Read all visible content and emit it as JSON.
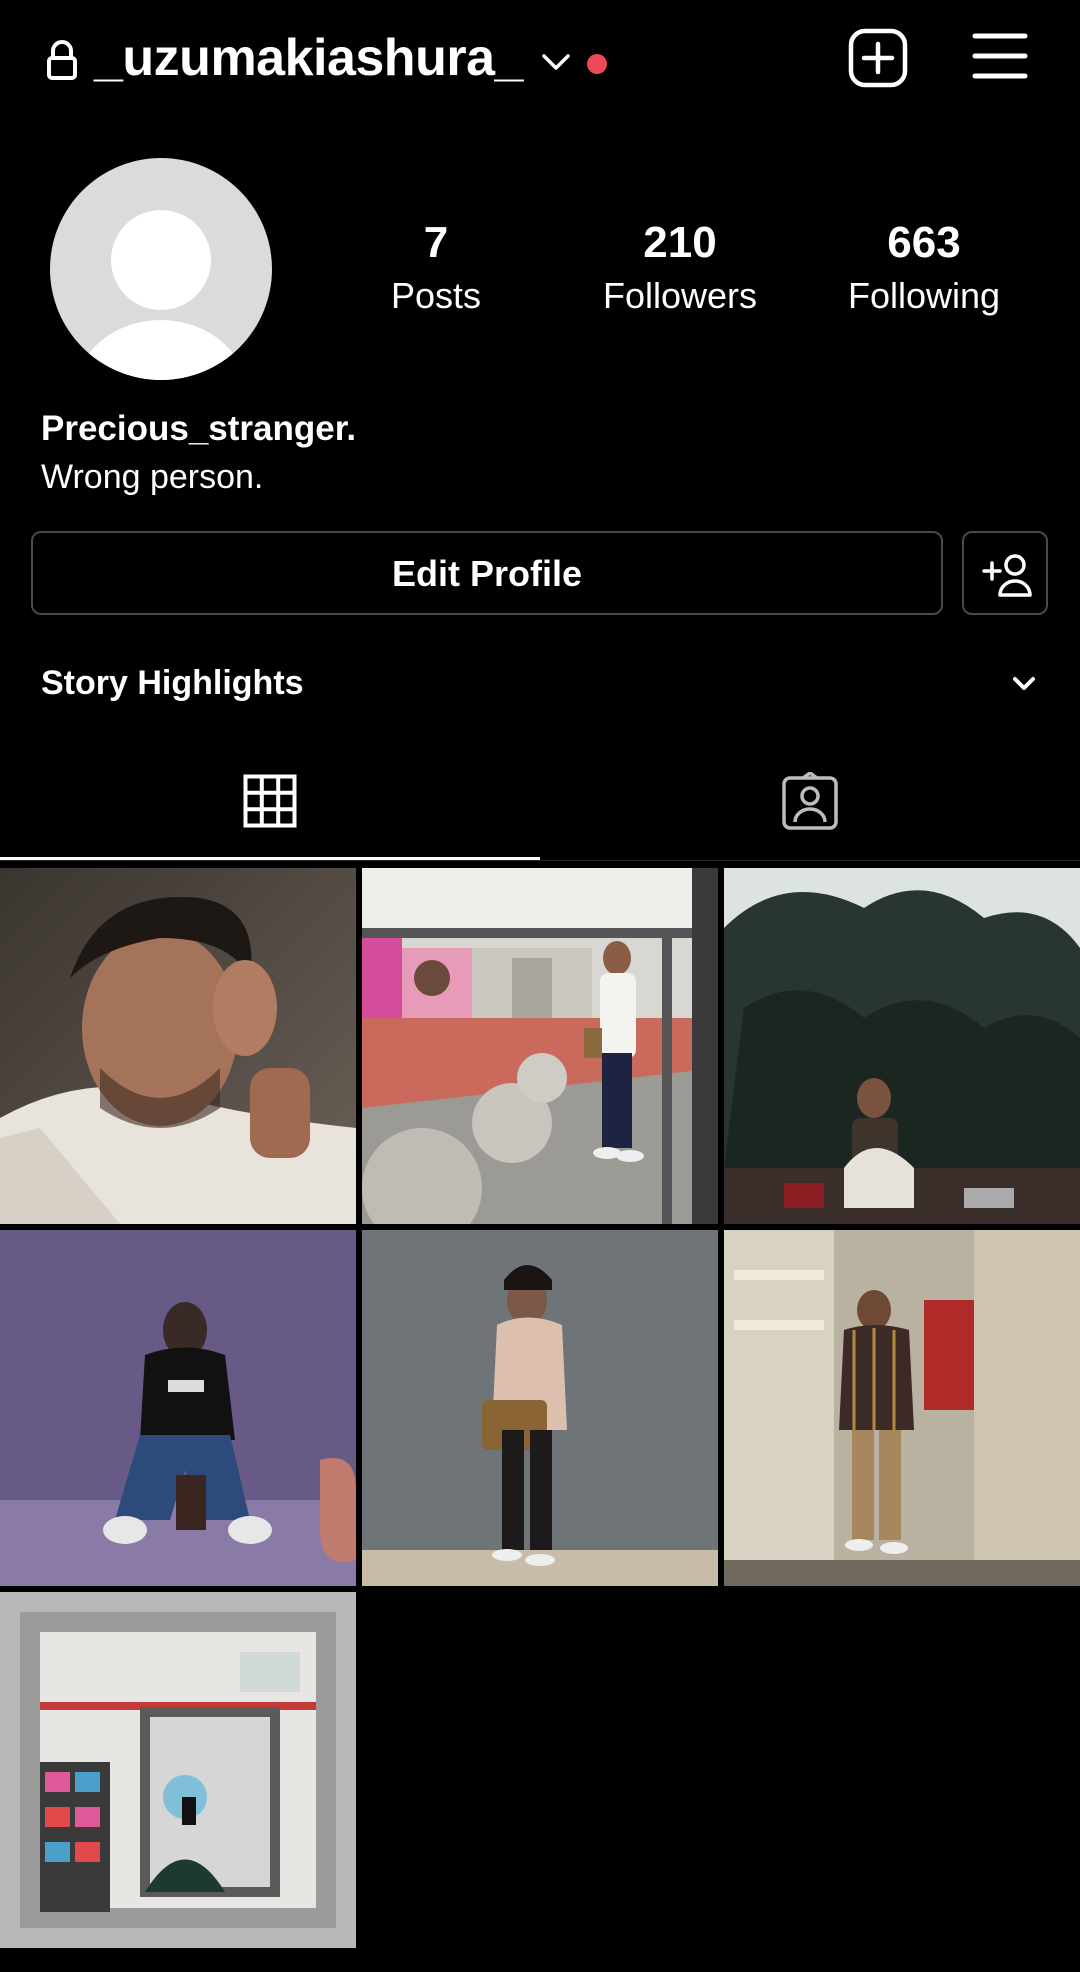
{
  "header": {
    "username": "_uzumakiashura_",
    "icons": [
      "lock-icon",
      "chevron-down-icon",
      "notification-dot",
      "new-post-icon",
      "menu-icon"
    ],
    "accent_color": "#ed4956"
  },
  "profile": {
    "stats": [
      {
        "value": "7",
        "label": "Posts"
      },
      {
        "value": "210",
        "label": "Followers"
      },
      {
        "value": "663",
        "label": "Following"
      }
    ],
    "name": "Precious_stranger.",
    "bio": "Wrong person."
  },
  "actions": {
    "edit_profile_label": "Edit Profile",
    "discover_icon": "add-person-icon"
  },
  "highlights": {
    "label": "Story Highlights"
  },
  "tabs": [
    {
      "icon": "grid-icon",
      "selected": true
    },
    {
      "icon": "tagged-person-icon",
      "selected": false
    }
  ],
  "posts": [
    {
      "description": "Close-up portrait, man in white shirt, hand on temple"
    },
    {
      "description": "Man standing by concrete spheres at bus stop"
    },
    {
      "description": "Man sitting under a pine tree"
    },
    {
      "description": "Man in black hoodie seated against purple wall"
    },
    {
      "description": "Man with shoulder bag against grey wall"
    },
    {
      "description": "Mirror selfie in striped shirt"
    },
    {
      "description": "Masked mirror selfie in ornate frame"
    }
  ],
  "colors": {
    "background": "#000000",
    "text": "#ffffff",
    "border": "#4a4a4a",
    "avatar_placeholder": "#dbdbdb"
  }
}
